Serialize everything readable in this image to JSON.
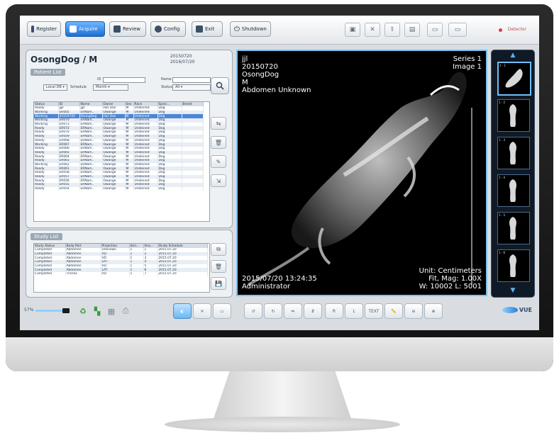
{
  "toolbar": {
    "buttons": [
      {
        "label": "Register",
        "icon": "register-icon"
      },
      {
        "label": "Acquire",
        "icon": "acquire-icon",
        "active": true
      },
      {
        "label": "Review",
        "icon": "review-icon"
      },
      {
        "label": "Config",
        "icon": "config-icon"
      },
      {
        "label": "Exit",
        "icon": "exit-icon"
      },
      {
        "label": "Shutdown",
        "icon": "shutdown-icon"
      }
    ],
    "status_text": "Detector"
  },
  "patient": {
    "name": "OsongDog / M",
    "date1": "20150720",
    "date2": "2016/07/20",
    "section_label": "Patient List"
  },
  "search": {
    "id_label": "ID",
    "name_label": "Name",
    "scope": "Local DB",
    "schedule_label": "Schedule",
    "schedule_value": "Month",
    "status_label": "Status",
    "status_value": "All"
  },
  "patient_table": {
    "headers": [
      "Status",
      "ID",
      "Name",
      "Owner",
      "Sex",
      "Race",
      "Speci...",
      "Breed"
    ],
    "selected_index": 2,
    "rows": [
      [
        "Ready",
        "jjjll",
        "jjjll",
        "Hot Dan",
        "M",
        "Undeined",
        "Dog",
        ""
      ],
      [
        "Working",
        "ER005",
        "ERNam..",
        "Owange",
        "M",
        "Undeined",
        "Dog",
        ""
      ],
      [
        "Working",
        "20150720",
        "OsongDog",
        "Hot Dan",
        "M",
        "Undeined",
        "Dog",
        ""
      ],
      [
        "Working",
        "ER070",
        "ERNam..",
        "Owange",
        "M",
        "Undeined",
        "Dog",
        ""
      ],
      [
        "Working",
        "ER073",
        "ERNam..",
        "Owange",
        "M",
        "Undeined",
        "Dog",
        ""
      ],
      [
        "Ready",
        "ER072",
        "ERNam..",
        "Owange",
        "M",
        "Undeined",
        "Dog",
        ""
      ],
      [
        "Ready",
        "ER070",
        "ERNam..",
        "Owange",
        "M",
        "Undeined",
        "Dog",
        ""
      ],
      [
        "Ready",
        "ER059",
        "ERNam..",
        "Owange",
        "M",
        "Undeined",
        "Dog",
        ""
      ],
      [
        "Ready",
        "ER068",
        "ERNam..",
        "Owange",
        "M",
        "Undeined",
        "Dog",
        ""
      ],
      [
        "Working",
        "ER067",
        "ERNam..",
        "Owange",
        "M",
        "Undeined",
        "Dog",
        ""
      ],
      [
        "Ready",
        "ER066",
        "ERNam..",
        "Owange",
        "M",
        "Undeined",
        "Dog",
        ""
      ],
      [
        "Ready",
        "ER065",
        "ERNam..",
        "Owange",
        "M",
        "Undeined",
        "Dog",
        ""
      ],
      [
        "Ready",
        "ER064",
        "ERNam..",
        "Owange",
        "M",
        "Undeined",
        "Dog",
        ""
      ],
      [
        "Ready",
        "ER063",
        "ERNam..",
        "Owange",
        "M",
        "Undeined",
        "Dog",
        ""
      ],
      [
        "Working",
        "ER062",
        "ERNam..",
        "Owange",
        "M",
        "Undeined",
        "Dog",
        ""
      ],
      [
        "Ready",
        "ER061",
        "ERNam..",
        "Owange",
        "M",
        "Undeined",
        "Dog",
        ""
      ],
      [
        "Ready",
        "ER058",
        "ERNam..",
        "Owange",
        "M",
        "Undeined",
        "Dog",
        ""
      ],
      [
        "Ready",
        "ER057",
        "ERNam..",
        "Owange",
        "M",
        "Undeined",
        "Dog",
        ""
      ],
      [
        "Ready",
        "ER056",
        "ERNam..",
        "Owange",
        "M",
        "Undeined",
        "Dog",
        ""
      ],
      [
        "Ready",
        "ER055",
        "ERNam..",
        "Owange",
        "M",
        "Undeined",
        "Dog",
        ""
      ],
      [
        "Ready",
        "ER054",
        "ERNam..",
        "Owange",
        "M",
        "Undeined",
        "Dog",
        ""
      ]
    ]
  },
  "study": {
    "section_label": "Study List",
    "headers": [
      "Study Status",
      "Body Part",
      "Projection",
      "Seri...",
      "Ima...",
      "Study Schedule"
    ],
    "rows": [
      [
        "Completed",
        "Abdomen",
        "Unknown",
        "1",
        "1",
        "2015.07.20"
      ],
      [
        "Completed",
        "Abdomen",
        "VD",
        "1",
        "2",
        "2015.07.20"
      ],
      [
        "Completed",
        "Abdomen",
        "VD",
        "1",
        "3",
        "2015.07.20"
      ],
      [
        "Completed",
        "Abdomen",
        "LAT",
        "1",
        "4",
        "2015.07.20"
      ],
      [
        "Completed",
        "Abdomen",
        "VD",
        "1",
        "5",
        "2015.07.20"
      ],
      [
        "Completed",
        "Abdomen",
        "LAT",
        "1",
        "6",
        "2015.07.20"
      ],
      [
        "Completed",
        "Thorax",
        "VD",
        "1",
        "7",
        "2015.07.20"
      ]
    ]
  },
  "viewer": {
    "top_left": [
      "jjl",
      "20150720",
      "OsongDog",
      "M",
      "Abdomen Unknown"
    ],
    "series": "Series 1",
    "image": "Image 1",
    "datetime": "2015/07/20 13:24:35",
    "operator": "Administrator",
    "unit": "Unit: Centimeters",
    "fit": "Fit, Mag: 1.00X",
    "wl": "W: 10002 L: 5001"
  },
  "thumbnails": [
    "1 - 1",
    "1 - 2",
    "1 - 3",
    "1 - 4",
    "1 - 5",
    "1 - 6"
  ],
  "bottom": {
    "zoom": "57%",
    "text_tool": "TEXT",
    "r_label": "R",
    "l_label": "L",
    "brand": "VUE"
  },
  "colors": {
    "accent": "#1d6fd1",
    "selection": "#4c86d6",
    "viewer_border": "#7fbff0"
  }
}
